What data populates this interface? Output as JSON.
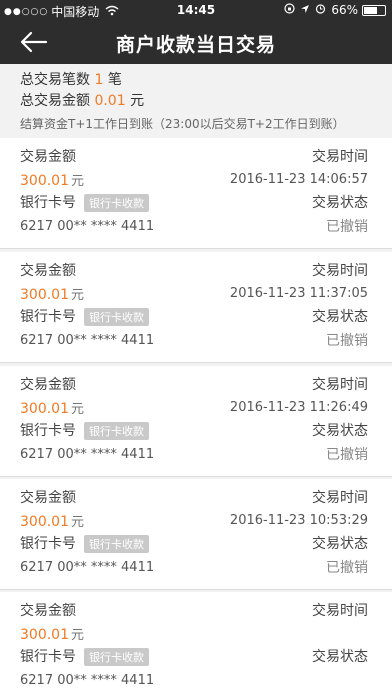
{
  "status_bar": {
    "carrier": "中国移动",
    "time": "14:45",
    "battery": "66%",
    "battery_level": 0.66
  },
  "nav": {
    "back_icon": "back-arrow-icon",
    "title": "商户收款当日交易"
  },
  "summary": {
    "count_label": "总交易笔数",
    "count_value": "1",
    "count_unit": "笔",
    "amount_label": "总交易金额",
    "amount_value": "0.01",
    "amount_unit": "元",
    "notice": "结算资金T+1工作日到账（23:00以后交易T+2工作日到账）"
  },
  "labels": {
    "amount": "交易金额",
    "time": "交易时间",
    "card": "银行卡号",
    "status": "交易状态",
    "currency": "元",
    "badge": "银行卡收款"
  },
  "transactions": [
    {
      "amount": "300.01",
      "time": "2016-11-23 14:06:57",
      "card": "6217 00** **** 4411",
      "status": "已撤销"
    },
    {
      "amount": "300.01",
      "time": "2016-11-23 11:37:05",
      "card": "6217 00** **** 4411",
      "status": "已撤销"
    },
    {
      "amount": "300.01",
      "time": "2016-11-23 11:26:49",
      "card": "6217 00** **** 4411",
      "status": "已撤销"
    },
    {
      "amount": "300.01",
      "time": "2016-11-23 10:53:29",
      "card": "6217 00** **** 4411",
      "status": "已撤销"
    },
    {
      "amount": "300.01",
      "time": "",
      "card": "6217 00** **** 4411",
      "status": ""
    }
  ]
}
